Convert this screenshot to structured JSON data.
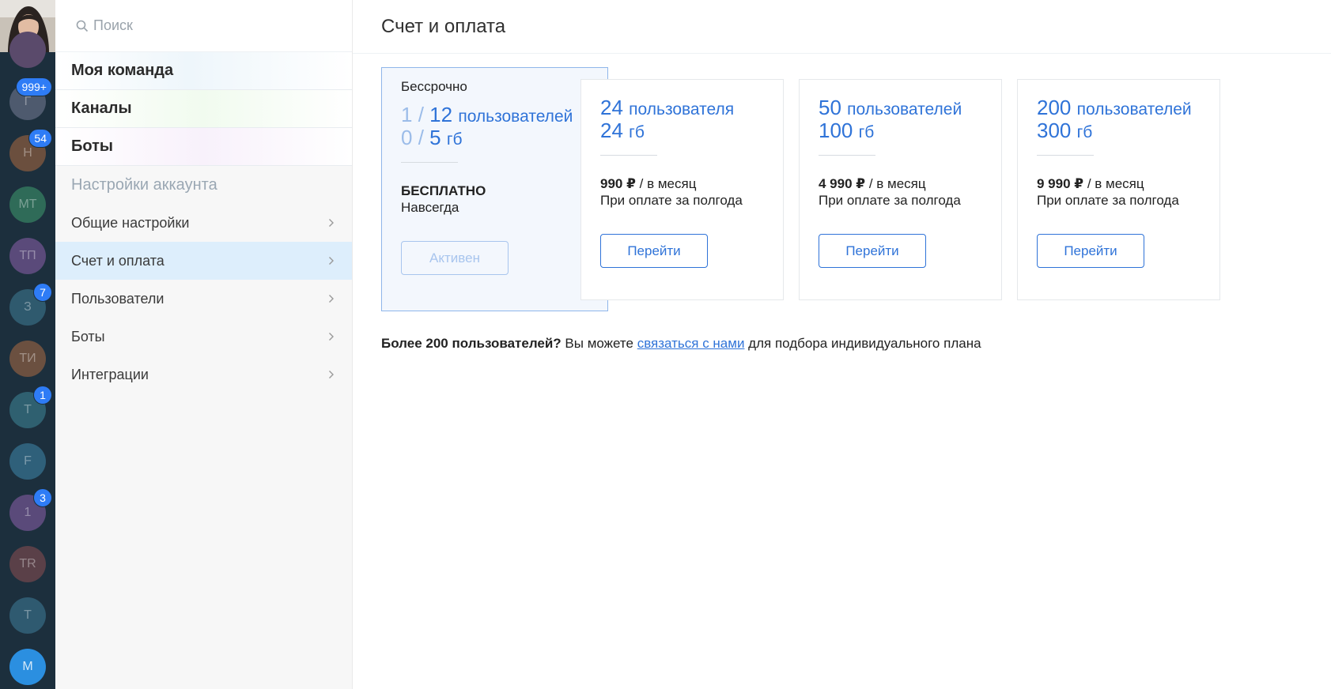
{
  "search": {
    "placeholder": "Поиск"
  },
  "teams": [
    {
      "initials": "",
      "color": "#5a4a6b",
      "badge": ""
    },
    {
      "initials": "Г",
      "color": "#4e5a6e",
      "badge": "999+"
    },
    {
      "initials": "Н",
      "color": "#6b4f3e",
      "badge": "54"
    },
    {
      "initials": "МТ",
      "color": "#2f6b58",
      "badge": ""
    },
    {
      "initials": "ТП",
      "color": "#5a4a7a",
      "badge": ""
    },
    {
      "initials": "З",
      "color": "#2f5a6e",
      "badge": "7"
    },
    {
      "initials": "ТИ",
      "color": "#6b5040",
      "badge": ""
    },
    {
      "initials": "Т",
      "color": "#2f6070",
      "badge": "1"
    },
    {
      "initials": "F",
      "color": "#2f607a",
      "badge": ""
    },
    {
      "initials": "1",
      "color": "#5a4a7a",
      "badge": "3"
    },
    {
      "initials": "TR",
      "color": "#5a4048",
      "badge": ""
    },
    {
      "initials": "Т",
      "color": "#2f5a70",
      "badge": ""
    },
    {
      "initials": "M",
      "color": "#2b8fe0",
      "badge": ""
    }
  ],
  "sections": [
    "Моя команда",
    "Каналы",
    "Боты"
  ],
  "account_header": "Настройки аккаунта",
  "menu": [
    {
      "label": "Общие настройки"
    },
    {
      "label": "Счет и оплата"
    },
    {
      "label": "Пользователи"
    },
    {
      "label": "Боты"
    },
    {
      "label": "Интеграции"
    }
  ],
  "page_title": "Счет и оплата",
  "current_plan": {
    "type": "Бессрочно",
    "users_used": "1",
    "users_limit": "12",
    "users_unit": "пользователей",
    "storage_used": "0",
    "storage_limit": "5",
    "storage_unit": "гб",
    "price": "БЕСПЛАТНО",
    "period": "Навсегда",
    "button": "Активен",
    "slash": "/"
  },
  "plans": [
    {
      "users": "24",
      "users_unit": "пользователя",
      "storage": "24",
      "storage_unit": "гб",
      "price": "990 ₽",
      "per": " / в месяц",
      "billing": "При оплате за полгода",
      "button": "Перейти"
    },
    {
      "users": "50",
      "users_unit": "пользователей",
      "storage": "100",
      "storage_unit": "гб",
      "price": "4 990 ₽",
      "per": " / в месяц",
      "billing": "При оплате за полгода",
      "button": "Перейти"
    },
    {
      "users": "200",
      "users_unit": "пользователей",
      "storage": "300",
      "storage_unit": "гб",
      "price": "9 990 ₽",
      "per": " / в месяц",
      "billing": "При оплате за полгода",
      "button": "Перейти"
    }
  ],
  "note": {
    "bold": "Более 200 пользователей?",
    "before": " Вы можете ",
    "link": "связаться с нами",
    "after": " для подбора индивидуального плана"
  }
}
